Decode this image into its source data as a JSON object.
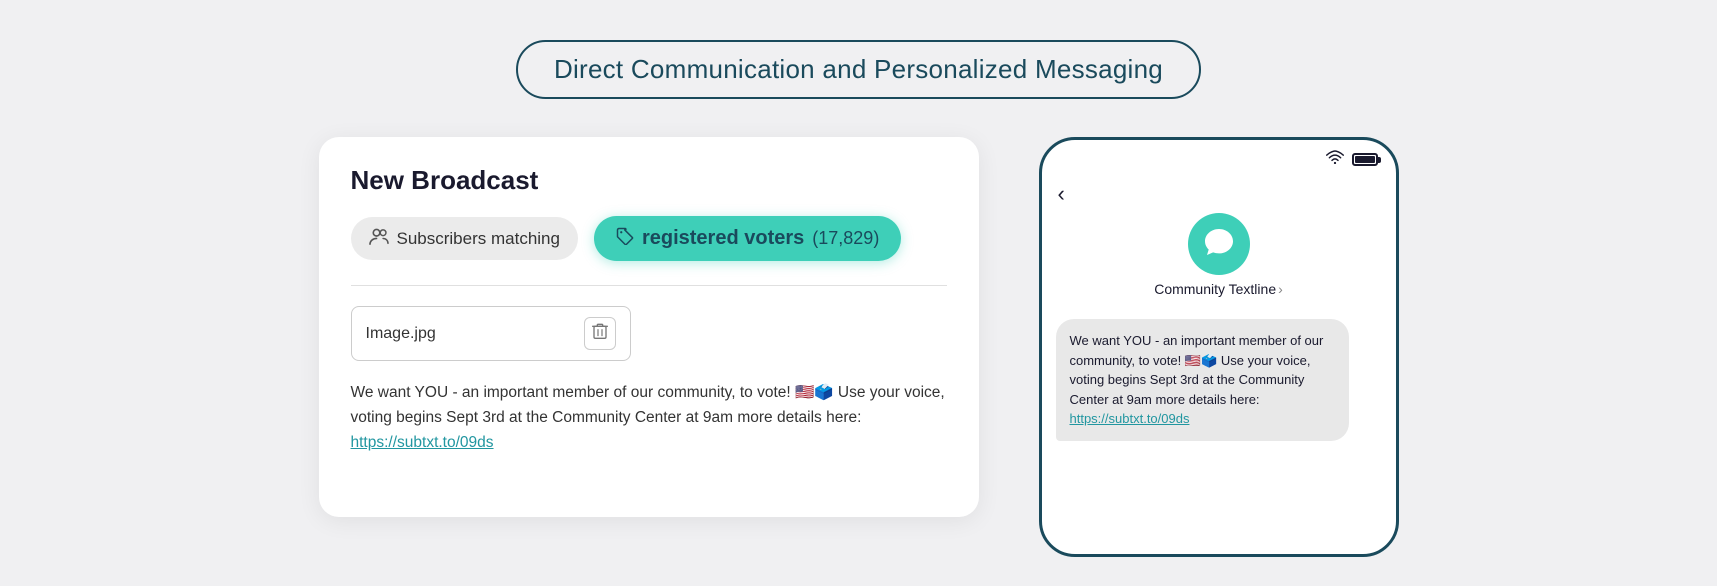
{
  "header": {
    "title": "Direct Communication and Personalized Messaging"
  },
  "broadcast_card": {
    "title": "New Broadcast",
    "subscribers_label": "Subscribers matching",
    "tag_label": "registered voters",
    "tag_count": "(17,829)",
    "image_filename": "Image.jpg",
    "message_text": "We want YOU - an important member of our community, to vote! 🇺🇸🗳️\nUse your voice, voting begins Sept 3rd at the Community Center at 9am\nmore details here: ",
    "message_link": "https://subtxt.to/09ds"
  },
  "phone": {
    "contact_name": "Community Textline",
    "contact_arrow": "›",
    "message_text": "We want YOU - an important member of our community, to vote! 🇺🇸🗳️\nUse your voice, voting begins Sept 3rd at the Community Center at 9am\nmore details here: ",
    "message_link": "https://subtxt.to/09ds"
  },
  "icons": {
    "subscribers": "👥",
    "tag": "🏷",
    "trash": "🗑",
    "chat": "💬",
    "back": "‹",
    "wifi": "wifi",
    "battery": "battery"
  }
}
